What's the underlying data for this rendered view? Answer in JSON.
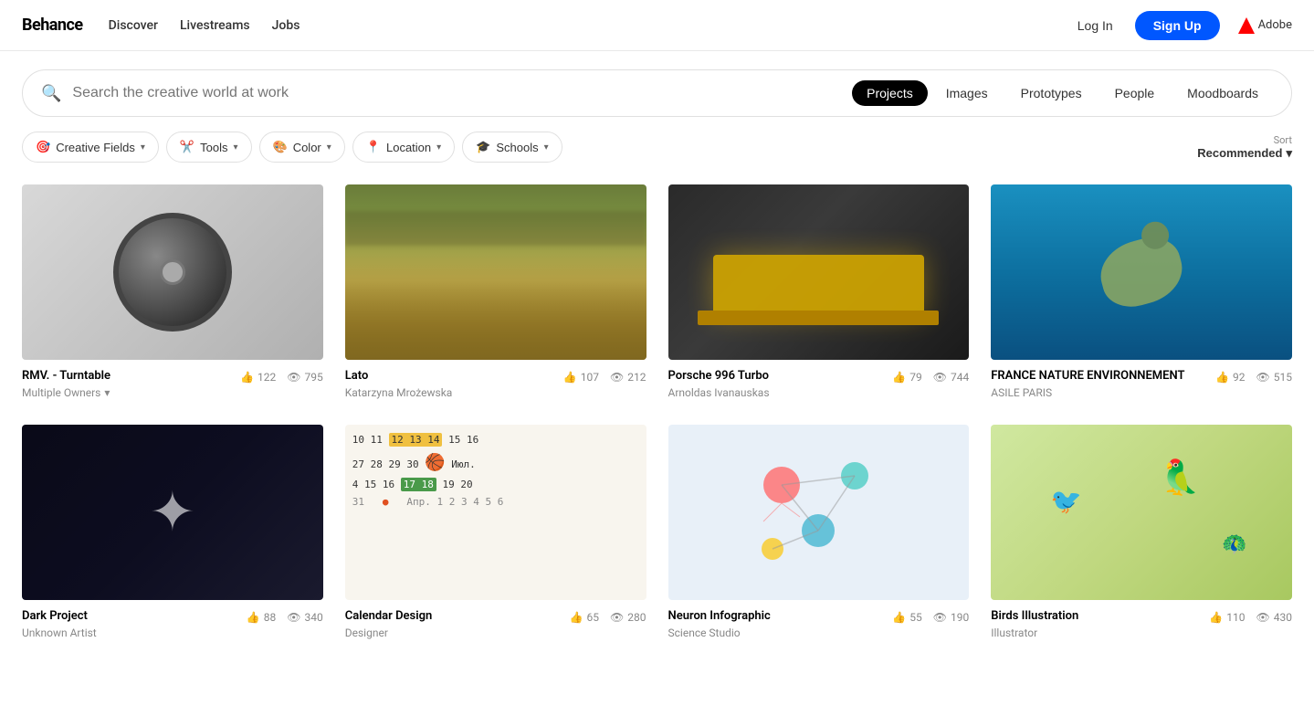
{
  "navbar": {
    "logo": "Behance",
    "links": [
      "Discover",
      "Livestreams",
      "Jobs"
    ],
    "login_label": "Log In",
    "signup_label": "Sign Up",
    "adobe_label": "Adobe"
  },
  "search": {
    "placeholder": "Search the creative world at work",
    "tabs": [
      "Projects",
      "Images",
      "Prototypes",
      "People",
      "Moodboards"
    ],
    "active_tab": "Projects"
  },
  "filters": {
    "creative_fields": "Creative Fields",
    "tools": "Tools",
    "color": "Color",
    "location": "Location",
    "schools": "Schools",
    "sort_label": "Sort",
    "sort_value": "Recommended"
  },
  "projects": [
    {
      "title": "RMV. - Turntable",
      "owner": "Multiple Owners",
      "owner_has_arrow": true,
      "likes": "122",
      "views": "795",
      "thumb_type": "turntable"
    },
    {
      "title": "Lato",
      "owner": "Katarzyna Mrożewska",
      "owner_has_arrow": false,
      "likes": "107",
      "views": "212",
      "thumb_type": "field"
    },
    {
      "title": "Porsche 996 Turbo",
      "owner": "Arnoldas Ivanauskas",
      "owner_has_arrow": false,
      "likes": "79",
      "views": "744",
      "thumb_type": "porsche"
    },
    {
      "title": "FRANCE NATURE ENVIRONNEMENT",
      "owner": "ASILE PARIS",
      "owner_has_arrow": false,
      "likes": "92",
      "views": "515",
      "thumb_type": "turtle"
    },
    {
      "title": "Dark Project",
      "owner": "Unknown Artist",
      "owner_has_arrow": false,
      "likes": "88",
      "views": "340",
      "thumb_type": "dark"
    },
    {
      "title": "Calendar Design",
      "owner": "Designer",
      "owner_has_arrow": false,
      "likes": "65",
      "views": "280",
      "thumb_type": "calendar"
    },
    {
      "title": "Neuron Infographic",
      "owner": "Science Studio",
      "owner_has_arrow": false,
      "likes": "55",
      "views": "190",
      "thumb_type": "neurons"
    },
    {
      "title": "Birds Illustration",
      "owner": "Illustrator",
      "owner_has_arrow": false,
      "likes": "110",
      "views": "430",
      "thumb_type": "birds"
    }
  ]
}
